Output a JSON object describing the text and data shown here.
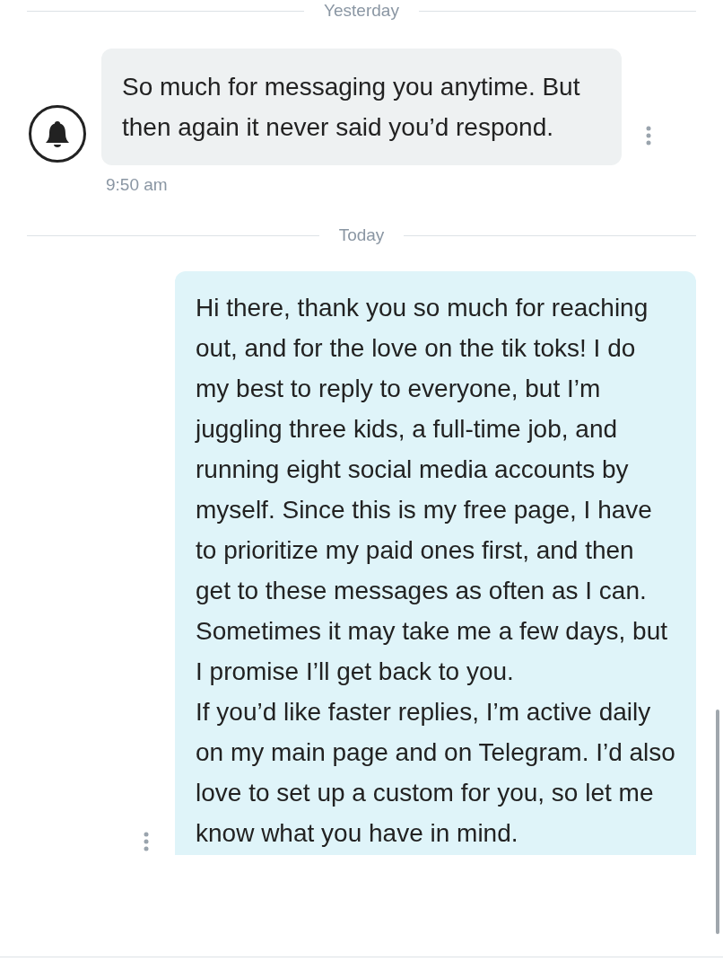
{
  "messages": [
    {
      "kind": "divider",
      "label": "Yesterday"
    },
    {
      "kind": "received",
      "paragraphs": [
        "So much for messaging you anytime. But then again it never said you’d respond."
      ],
      "time": "9:50 am"
    },
    {
      "kind": "divider",
      "label": "Today"
    },
    {
      "kind": "sent",
      "paragraphs": [
        "Hi there, thank you so much for reaching out, and for the love on the tik toks! I do my best to reply to everyone, but I’m juggling three kids, a full-time job, and running eight social media accounts by myself. Since this is my free page, I have to prioritize my paid ones first, and then get to these messages as often as I can. Sometimes it may take me a few days, but I promise I’ll get back to you.",
        "If you’d like faster replies, I’m active daily on my main page and on Telegram. I’d also love to set up a custom for you, so let me know what you have in mind."
      ]
    }
  ]
}
